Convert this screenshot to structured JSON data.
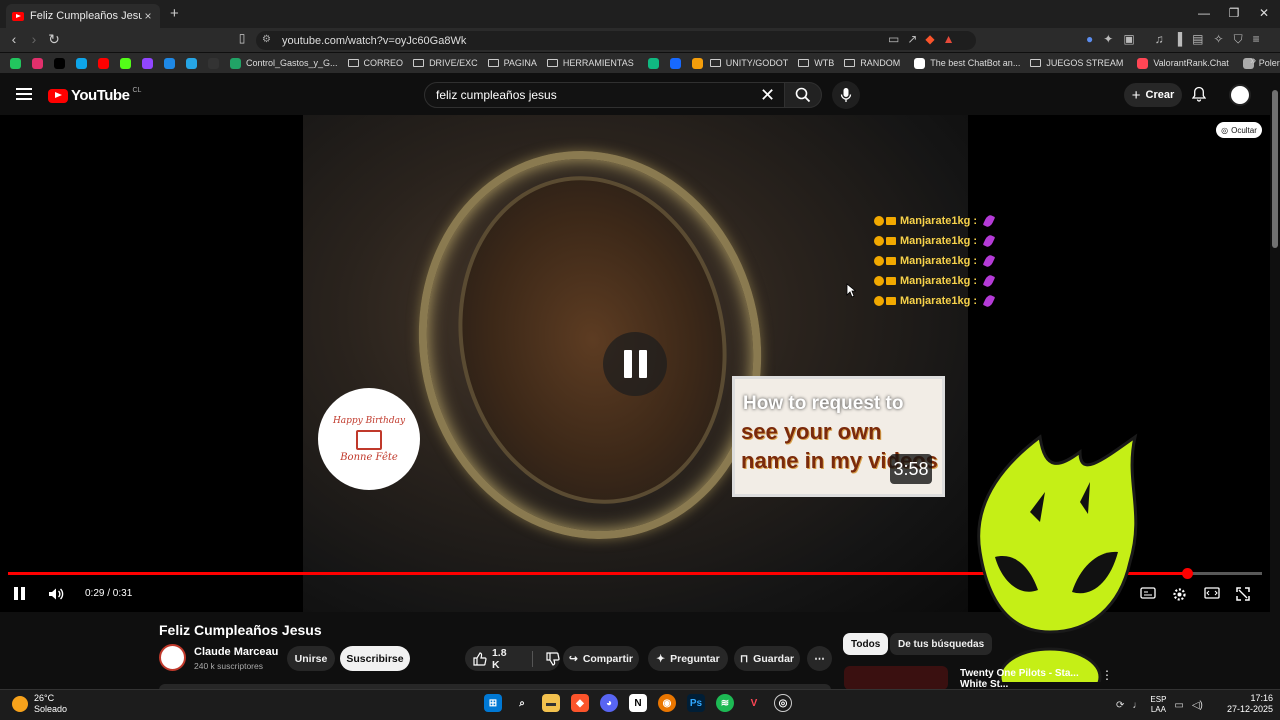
{
  "browser": {
    "tab_title": "Feliz Cumpleaños Jesus - You",
    "tab_close": "×",
    "new_tab": "+",
    "url": "youtube.com/watch?v=oyJc60Ga8Wk",
    "window": {
      "minimize": "—",
      "maximize": "❐",
      "close": "✕"
    }
  },
  "bookmarks": [
    {
      "label": "",
      "color": "#22c55e"
    },
    {
      "label": "",
      "color": "#e1306c"
    },
    {
      "label": "",
      "color": "#000000"
    },
    {
      "label": "",
      "color": "#0ea5e9"
    },
    {
      "label": "",
      "color": "#ff0000"
    },
    {
      "label": "",
      "color": "#53fc18"
    },
    {
      "label": "",
      "color": "#9146ff"
    },
    {
      "label": "",
      "color": "#1e88e5"
    },
    {
      "label": "",
      "color": "#26a5e4"
    },
    {
      "label": "",
      "color": "#333333"
    },
    {
      "label": "Control_Gastos_y_G...",
      "color": "#21a366"
    },
    {
      "label": "CORREO",
      "folder": true
    },
    {
      "label": "DRIVE/EXC",
      "folder": true
    },
    {
      "label": "PAGINA",
      "folder": true
    },
    {
      "label": "HERRAMIENTAS",
      "folder": true
    },
    {
      "label": "",
      "color": "#10b981"
    },
    {
      "label": "",
      "color": "#1769ff"
    },
    {
      "label": "",
      "color": "#f59e0b"
    },
    {
      "label": "UNITY/GODOT",
      "folder": true
    },
    {
      "label": "WTB",
      "folder": true
    },
    {
      "label": "RANDOM",
      "folder": true
    },
    {
      "label": "The best ChatBot an...",
      "color": "#ffffff"
    },
    {
      "label": "JUEGOS STREAM",
      "folder": true
    },
    {
      "label": "ValorantRank.Chat",
      "color": "#ff4655"
    },
    {
      "label": "Polera manga corta...",
      "color": "#aaaaaa"
    }
  ],
  "youtube": {
    "logo_text": "YouTube",
    "logo_region": "CL",
    "search_value": "feliz cumpleaños jesus",
    "create_label": "Crear",
    "hide_label": "Ocultar"
  },
  "video": {
    "chat_user": "Manjarate1kg :",
    "chat_lines": 5,
    "bday_line1": "Happy Birthday",
    "bday_line2": "Bonne Fête",
    "card_title": "How to request to",
    "card_text": "see your own name in my videos",
    "card_duration": "3:58",
    "time_display": "0:29 / 0:31",
    "progress": 0.94
  },
  "meta": {
    "title": "Feliz Cumpleaños Jesus",
    "channel": "Claude Marceau",
    "subscribers": "240 k suscriptores",
    "join": "Unirse",
    "subscribe": "Suscribirse",
    "likes": "1.8 K",
    "share": "Compartir",
    "ask": "Preguntar",
    "save": "Guardar"
  },
  "chips": [
    "Todos",
    "De tus búsquedas"
  ],
  "recommendation": {
    "title": "Twenty One Pilots - Sta...",
    "subtitle": "White St..."
  },
  "taskbar": {
    "temp": "26°C",
    "weather": "Soleado",
    "lang1": "ESP",
    "lang2": "LAA",
    "time": "17:16",
    "date": "27-12-2025"
  }
}
